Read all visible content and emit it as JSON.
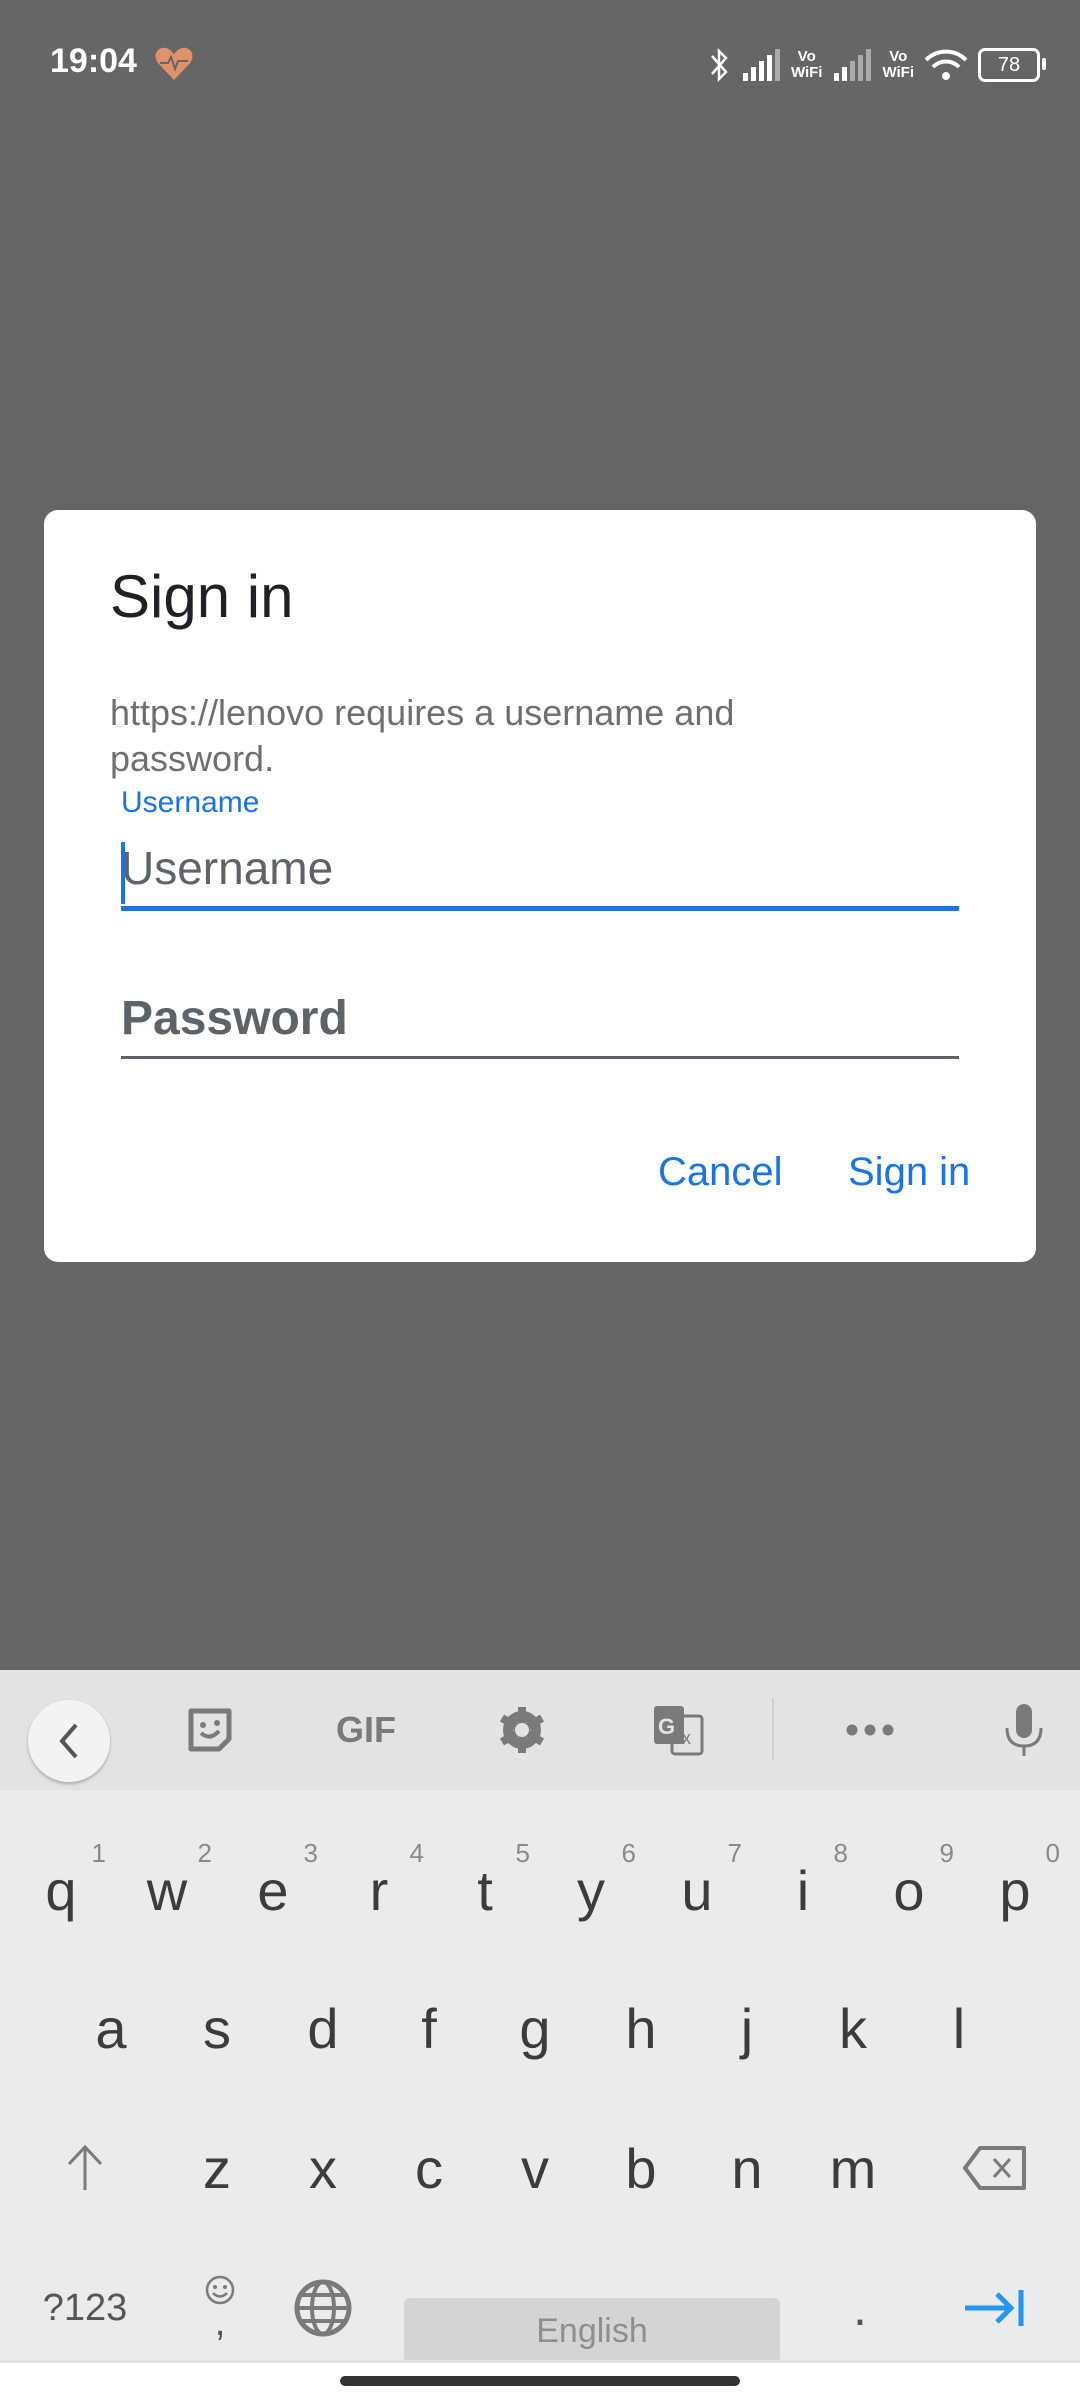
{
  "status_bar": {
    "time": "19:04",
    "vowifi_1": "Vo WiFi",
    "vowifi_2": "Vo WiFi",
    "battery": "78",
    "heart_color": "#e0916a"
  },
  "dialog": {
    "title": "Sign in",
    "message": "https://lenovo requires a username and password.",
    "username_label": "Username",
    "username_placeholder": "Username",
    "username_value": "",
    "password_placeholder": "Password",
    "password_value": "",
    "cancel_label": "Cancel",
    "signin_label": "Sign in",
    "accent_color": "#1a73e8"
  },
  "keyboard": {
    "toolbar": [
      "back",
      "sticker",
      "GIF",
      "settings",
      "translate",
      "more",
      "voice"
    ],
    "gif_label": "GIF",
    "row1": [
      {
        "k": "q",
        "h": "1"
      },
      {
        "k": "w",
        "h": "2"
      },
      {
        "k": "e",
        "h": "3"
      },
      {
        "k": "r",
        "h": "4"
      },
      {
        "k": "t",
        "h": "5"
      },
      {
        "k": "y",
        "h": "6"
      },
      {
        "k": "u",
        "h": "7"
      },
      {
        "k": "i",
        "h": "8"
      },
      {
        "k": "o",
        "h": "9"
      },
      {
        "k": "p",
        "h": "0"
      }
    ],
    "row2": [
      "a",
      "s",
      "d",
      "f",
      "g",
      "h",
      "j",
      "k",
      "l"
    ],
    "row3": [
      "z",
      "x",
      "c",
      "v",
      "b",
      "n",
      "m"
    ],
    "symbols_label": "?123",
    "comma": ",",
    "space_label": "English",
    "period": "."
  }
}
